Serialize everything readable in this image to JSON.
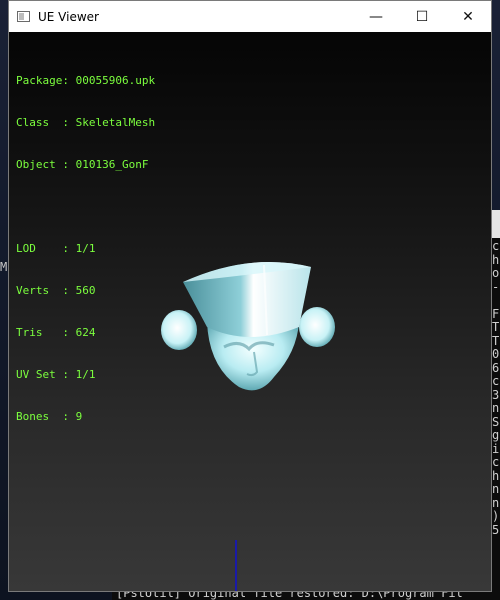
{
  "window": {
    "title": "UE Viewer"
  },
  "controls": {
    "minimize": "—",
    "maximize": "☐",
    "close": "✕"
  },
  "info": {
    "package_label": "Package:",
    "package_value": "00055906.upk",
    "class_label": "Class  :",
    "class_value": "SkeletalMesh",
    "object_label": "Object :",
    "object_value": "010136_GonF",
    "lod_label": "LOD    :",
    "lod_value": "1/1",
    "verts_label": "Verts  :",
    "verts_value": "560",
    "tris_label": "Tris   :",
    "tris_value": "624",
    "uvset_label": "UV Set :",
    "uvset_value": "1/1",
    "bones_label": "Bones  :",
    "bones_value": "9"
  },
  "background": {
    "left_char": "M",
    "console_lines": "c\nh\no\n-\n\nF\nT\nT\n0\n6\nc\n3\nn\nS\ng\ni\nc\nh\nn\nn\n)\n5",
    "console_bottom": "[PstUtil] Original file restored: D:\\Program Fil"
  },
  "colors": {
    "info_text": "#7cff3e",
    "axis": "#1a1aa8"
  }
}
